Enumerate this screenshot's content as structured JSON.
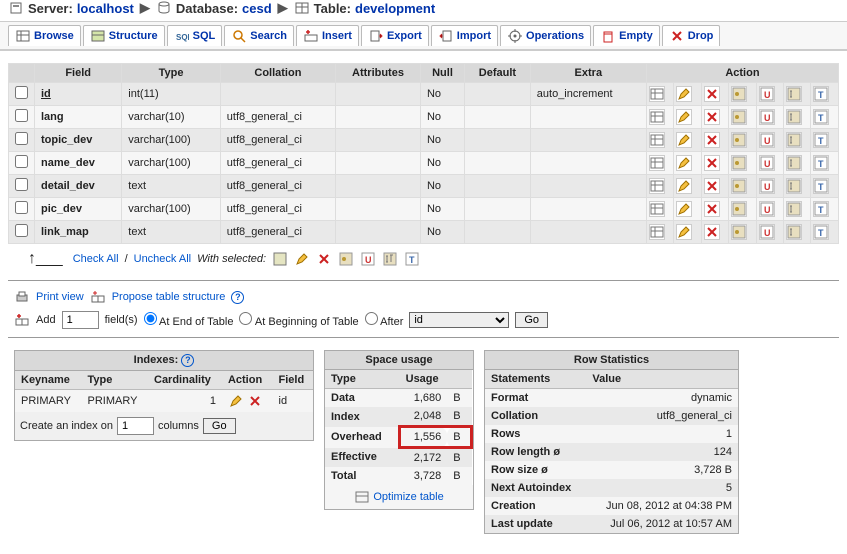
{
  "breadcrumb": {
    "server_lbl": "Server:",
    "server": "localhost",
    "db_lbl": "Database:",
    "db": "cesd",
    "table_lbl": "Table:",
    "table": "development"
  },
  "tabs": [
    {
      "key": "browse",
      "label": "Browse"
    },
    {
      "key": "structure",
      "label": "Structure"
    },
    {
      "key": "sql",
      "label": "SQL"
    },
    {
      "key": "search",
      "label": "Search"
    },
    {
      "key": "insert",
      "label": "Insert"
    },
    {
      "key": "export",
      "label": "Export"
    },
    {
      "key": "import",
      "label": "Import"
    },
    {
      "key": "operations",
      "label": "Operations"
    },
    {
      "key": "empty",
      "label": "Empty"
    },
    {
      "key": "drop",
      "label": "Drop"
    }
  ],
  "col_headers": [
    "Field",
    "Type",
    "Collation",
    "Attributes",
    "Null",
    "Default",
    "Extra",
    "Action"
  ],
  "columns": [
    {
      "field": "id",
      "type": "int(11)",
      "coll": "",
      "attr": "",
      "null": "No",
      "def": "",
      "extra": "auto_increment",
      "under": true
    },
    {
      "field": "lang",
      "type": "varchar(10)",
      "coll": "utf8_general_ci",
      "attr": "",
      "null": "No",
      "def": "",
      "extra": ""
    },
    {
      "field": "topic_dev",
      "type": "varchar(100)",
      "coll": "utf8_general_ci",
      "attr": "",
      "null": "No",
      "def": "",
      "extra": ""
    },
    {
      "field": "name_dev",
      "type": "varchar(100)",
      "coll": "utf8_general_ci",
      "attr": "",
      "null": "No",
      "def": "",
      "extra": ""
    },
    {
      "field": "detail_dev",
      "type": "text",
      "coll": "utf8_general_ci",
      "attr": "",
      "null": "No",
      "def": "",
      "extra": ""
    },
    {
      "field": "pic_dev",
      "type": "varchar(100)",
      "coll": "utf8_general_ci",
      "attr": "",
      "null": "No",
      "def": "",
      "extra": ""
    },
    {
      "field": "link_map",
      "type": "text",
      "coll": "utf8_general_ci",
      "attr": "",
      "null": "No",
      "def": "",
      "extra": ""
    }
  ],
  "checkrow": {
    "check_all": "Check All",
    "uncheck_all": "Uncheck All",
    "with": "With selected:"
  },
  "tools": {
    "print": "Print view",
    "propose": "Propose table structure",
    "add_prefix": "Add",
    "add_value": "1",
    "fields": "field(s)",
    "at_end": "At End of Table",
    "at_begin": "At Beginning of Table",
    "after": "After",
    "after_sel": "id",
    "go": "Go"
  },
  "indexes": {
    "title": "Indexes:",
    "headers": [
      "Keyname",
      "Type",
      "Cardinality",
      "Action",
      "Field"
    ],
    "rows": [
      {
        "key": "PRIMARY",
        "type": "PRIMARY",
        "card": "1",
        "field": "id"
      }
    ],
    "create1": "Create an index on",
    "create_val": "1",
    "create2": "columns",
    "go": "Go"
  },
  "space": {
    "title": "Space usage",
    "headers": [
      "Type",
      "Usage"
    ],
    "rows": [
      {
        "t": "Data",
        "u": "1,680",
        "s": "B"
      },
      {
        "t": "Index",
        "u": "2,048",
        "s": "B"
      },
      {
        "t": "Overhead",
        "u": "1,556",
        "s": "B",
        "hl": true
      },
      {
        "t": "Effective",
        "u": "2,172",
        "s": "B"
      },
      {
        "t": "Total",
        "u": "3,728",
        "s": "B"
      }
    ],
    "optimize": "Optimize table"
  },
  "stats": {
    "title": "Row Statistics",
    "headers": [
      "Statements",
      "Value"
    ],
    "rows": [
      {
        "k": "Format",
        "v": "dynamic"
      },
      {
        "k": "Collation",
        "v": "utf8_general_ci"
      },
      {
        "k": "Rows",
        "v": "1"
      },
      {
        "k": "Row length ø",
        "v": "124"
      },
      {
        "k": "Row size ø",
        "v": "3,728 B"
      },
      {
        "k": "Next Autoindex",
        "v": "5"
      },
      {
        "k": "Creation",
        "v": "Jun 08, 2012 at 04:38 PM"
      },
      {
        "k": "Last update",
        "v": "Jul 06, 2012 at 10:57 AM"
      }
    ]
  }
}
